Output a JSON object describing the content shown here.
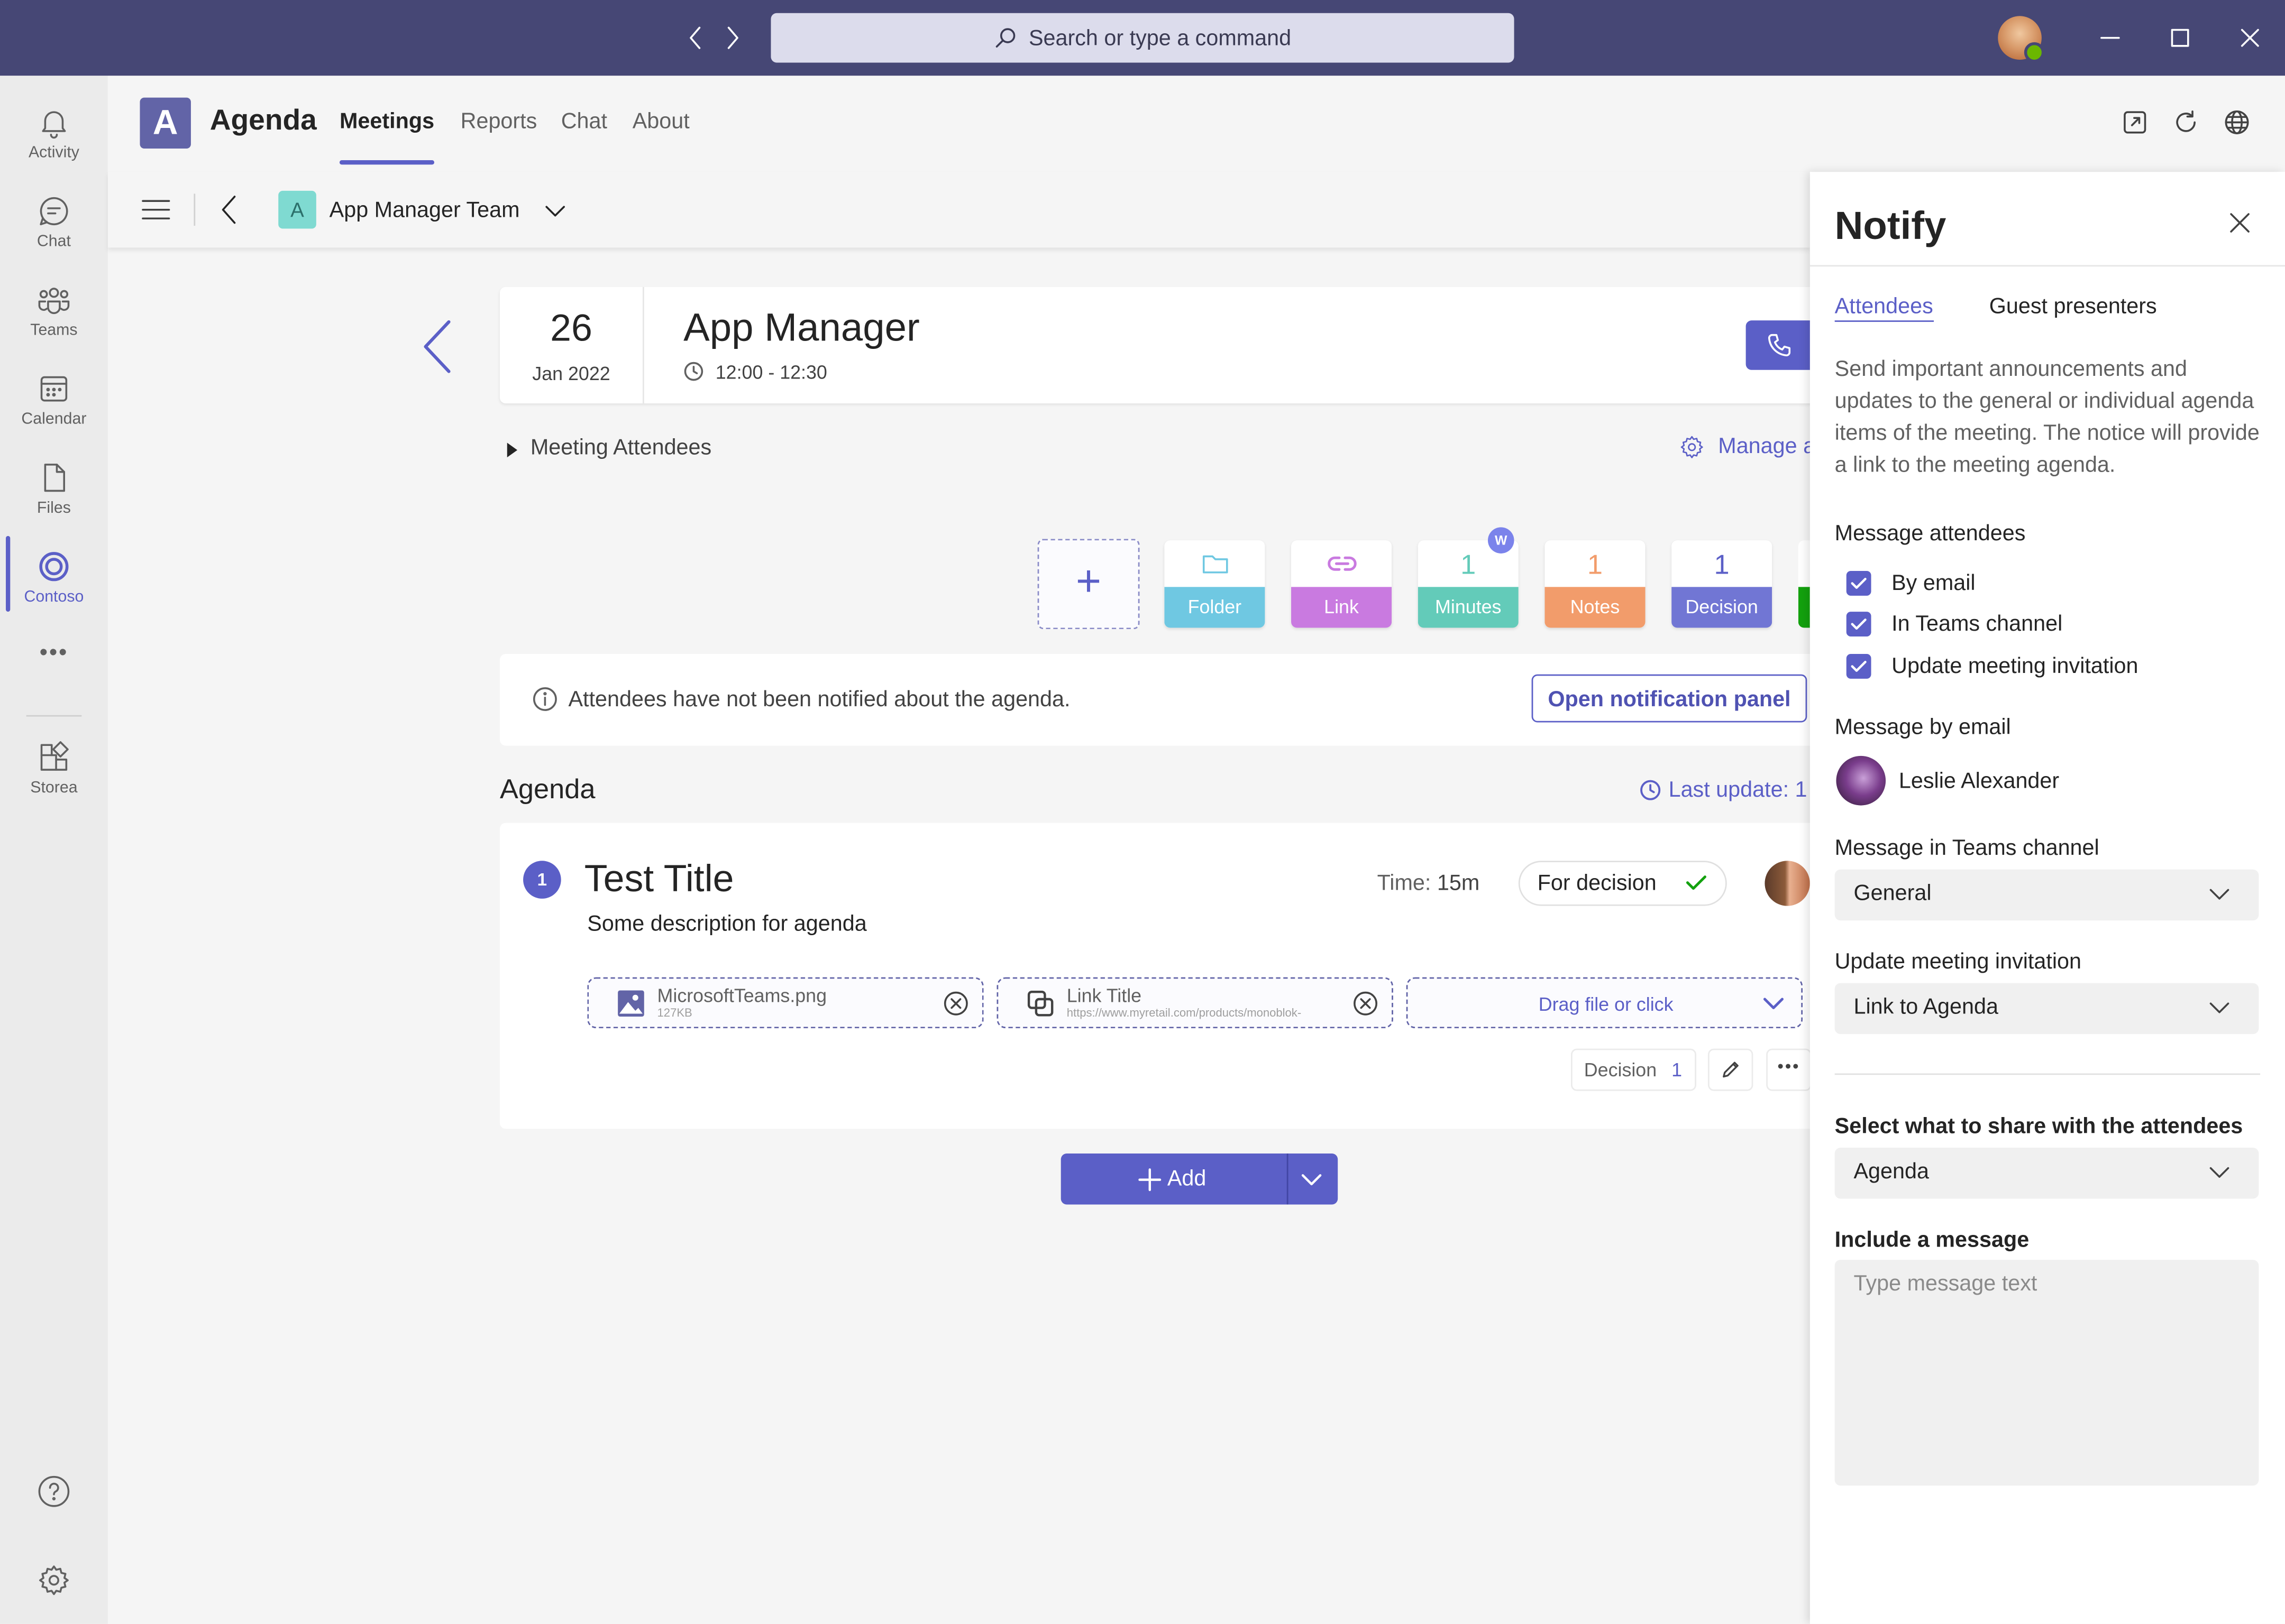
{
  "titlebar": {
    "search_placeholder": "Search or type a command"
  },
  "rail": {
    "items": [
      {
        "label": "Activity",
        "icon": "bell-icon"
      },
      {
        "label": "Chat",
        "icon": "chat-icon"
      },
      {
        "label": "Teams",
        "icon": "teams-icon"
      },
      {
        "label": "Calendar",
        "icon": "calendar-icon"
      },
      {
        "label": "Files",
        "icon": "file-icon"
      },
      {
        "label": "Contoso",
        "icon": "contoso-icon"
      },
      {
        "label": "Storea",
        "icon": "apps-icon"
      }
    ],
    "more": "•••"
  },
  "app": {
    "logo_letter": "A",
    "name": "Agenda",
    "tabs": [
      "Meetings",
      "Reports",
      "Chat",
      "About"
    ]
  },
  "subheader": {
    "team_letter": "A",
    "team_name": "App Manager Team"
  },
  "meeting": {
    "day": "26",
    "month_year": "Jan 2022",
    "title": "App Manager",
    "time": "12:00 - 12:30",
    "attendees_label": "Meeting Attendees",
    "manage_label": "Manage a"
  },
  "tiles": [
    {
      "label": "Folder",
      "color": "#6fc8e2",
      "icon": "folder-icon"
    },
    {
      "label": "Link",
      "color": "#c97ae0",
      "icon": "link-icon"
    },
    {
      "label": "Minutes",
      "count": "1",
      "color": "#63cbb9",
      "badge": "W"
    },
    {
      "label": "Notes",
      "count": "1",
      "color": "#f29c6b"
    },
    {
      "label": "Decision",
      "count": "1",
      "color": "#7176d4"
    }
  ],
  "notice": {
    "text": "Attendees have not been notified about the agenda.",
    "button": "Open notification panel"
  },
  "agenda": {
    "heading": "Agenda",
    "last_update": "Last update: 1",
    "item": {
      "number": "1",
      "title": "Test Title",
      "description": "Some description for agenda",
      "time_label": "Time:",
      "time_value": "15m",
      "status": "For decision",
      "attachments": [
        {
          "name": "MicrosoftTeams.png",
          "sub": "127KB"
        },
        {
          "name": "Link Title",
          "sub": "https://www.myretail.com/products/monoblok-"
        }
      ],
      "drop_hint": "Drag file or click",
      "decision_label": "Decision",
      "decision_count": "1"
    },
    "add_label": "Add"
  },
  "panel": {
    "title": "Notify",
    "tabs": [
      "Attendees",
      "Guest presenters"
    ],
    "description": "Send important announcements and updates to the general or individual agenda items of the meeting. The notice will provide a link to the meeting agenda.",
    "message_attendees_label": "Message attendees",
    "checkboxes": [
      "By email",
      "In Teams channel",
      "Update meeting invitation"
    ],
    "message_by_email_label": "Message by email",
    "email_person": "Leslie Alexander",
    "teams_channel_label": "Message in Teams channel",
    "teams_channel_value": "General",
    "invitation_label": "Update meeting invitation",
    "invitation_value": "Link to Agenda",
    "share_label": "Select what to share with the attendees",
    "share_value": "Agenda",
    "message_label": "Include a message",
    "message_placeholder": "Type message text"
  }
}
